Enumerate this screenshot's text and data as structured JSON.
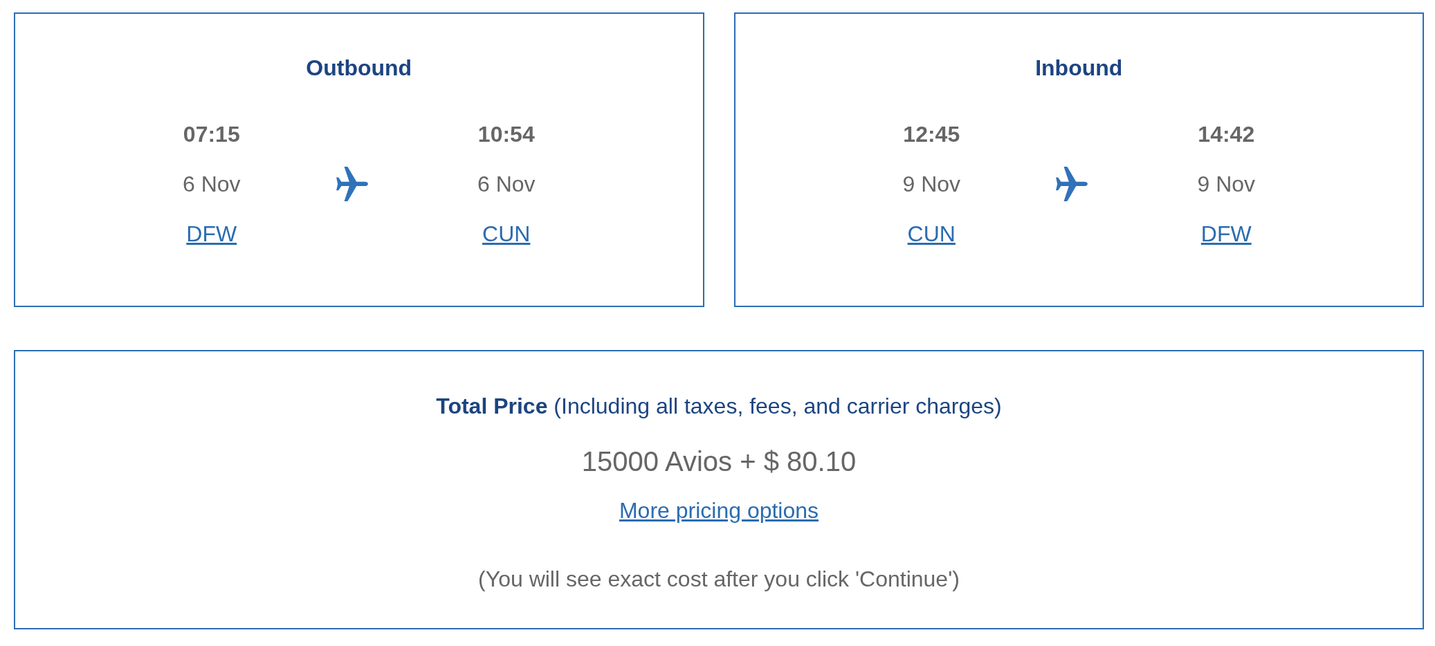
{
  "legs": [
    {
      "title": "Outbound",
      "departure": {
        "time": "07:15",
        "date": "6 Nov",
        "airport": "DFW"
      },
      "arrival": {
        "time": "10:54",
        "date": "6 Nov",
        "airport": "CUN"
      }
    },
    {
      "title": "Inbound",
      "departure": {
        "time": "12:45",
        "date": "9 Nov",
        "airport": "CUN"
      },
      "arrival": {
        "time": "14:42",
        "date": "9 Nov",
        "airport": "DFW"
      }
    }
  ],
  "price": {
    "heading": "**Total Price** (Including all taxes, fees, and carrier charges)",
    "amount": "15000 Avios + $ 80.10",
    "link": "More pricing options",
    "note": "(You will see exact cost after you click 'Continue')"
  }
}
